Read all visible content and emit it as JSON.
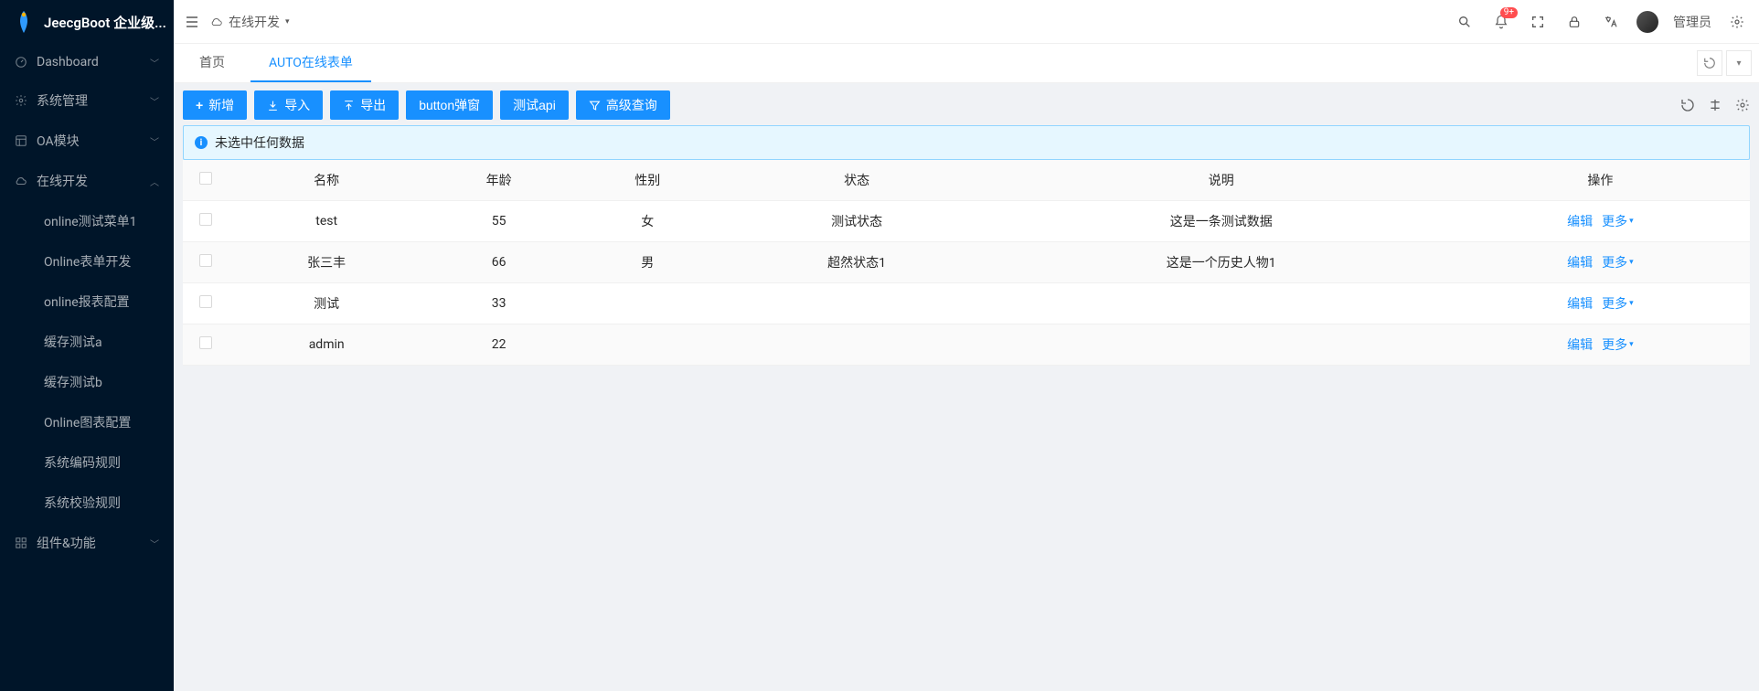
{
  "app": {
    "title": "JeecgBoot 企业级..."
  },
  "sidebar": {
    "items": [
      {
        "label": "Dashboard",
        "icon": "dashboard",
        "expandable": true,
        "open": false
      },
      {
        "label": "系统管理",
        "icon": "setting",
        "expandable": true,
        "open": false
      },
      {
        "label": "OA模块",
        "icon": "layout",
        "expandable": true,
        "open": false
      },
      {
        "label": "在线开发",
        "icon": "cloud",
        "expandable": true,
        "open": true,
        "children": [
          {
            "label": "online测试菜单1"
          },
          {
            "label": "Online表单开发"
          },
          {
            "label": "online报表配置"
          },
          {
            "label": "缓存测试a"
          },
          {
            "label": "缓存测试b"
          },
          {
            "label": "Online图表配置"
          },
          {
            "label": "系统编码规则"
          },
          {
            "label": "系统校验规则"
          }
        ]
      },
      {
        "label": "组件&功能",
        "icon": "appstore",
        "expandable": true,
        "open": false
      }
    ]
  },
  "header": {
    "breadcrumb": {
      "icon": "cloud",
      "text": "在线开发"
    },
    "notification_count": "9+",
    "username": "管理员"
  },
  "tabs": {
    "items": [
      {
        "label": "首页",
        "active": false
      },
      {
        "label": "AUTO在线表单",
        "active": true
      }
    ]
  },
  "toolbar": {
    "add": "新增",
    "import": "导入",
    "export": "导出",
    "button_popup": "button弹窗",
    "test_api": "测试api",
    "adv_query": "高级查询"
  },
  "alert": {
    "text": "未选中任何数据"
  },
  "table": {
    "columns": [
      "名称",
      "年龄",
      "性别",
      "状态",
      "说明",
      "操作"
    ],
    "rows": [
      {
        "name": "test",
        "age": "55",
        "gender": "女",
        "status": "测试状态",
        "desc": "这是一条测试数据"
      },
      {
        "name": "张三丰",
        "age": "66",
        "gender": "男",
        "status": "超然状态1",
        "desc": "这是一个历史人物1"
      },
      {
        "name": "测试",
        "age": "33",
        "gender": "",
        "status": "",
        "desc": ""
      },
      {
        "name": "admin",
        "age": "22",
        "gender": "",
        "status": "",
        "desc": ""
      }
    ],
    "action_edit": "编辑",
    "action_more": "更多"
  }
}
